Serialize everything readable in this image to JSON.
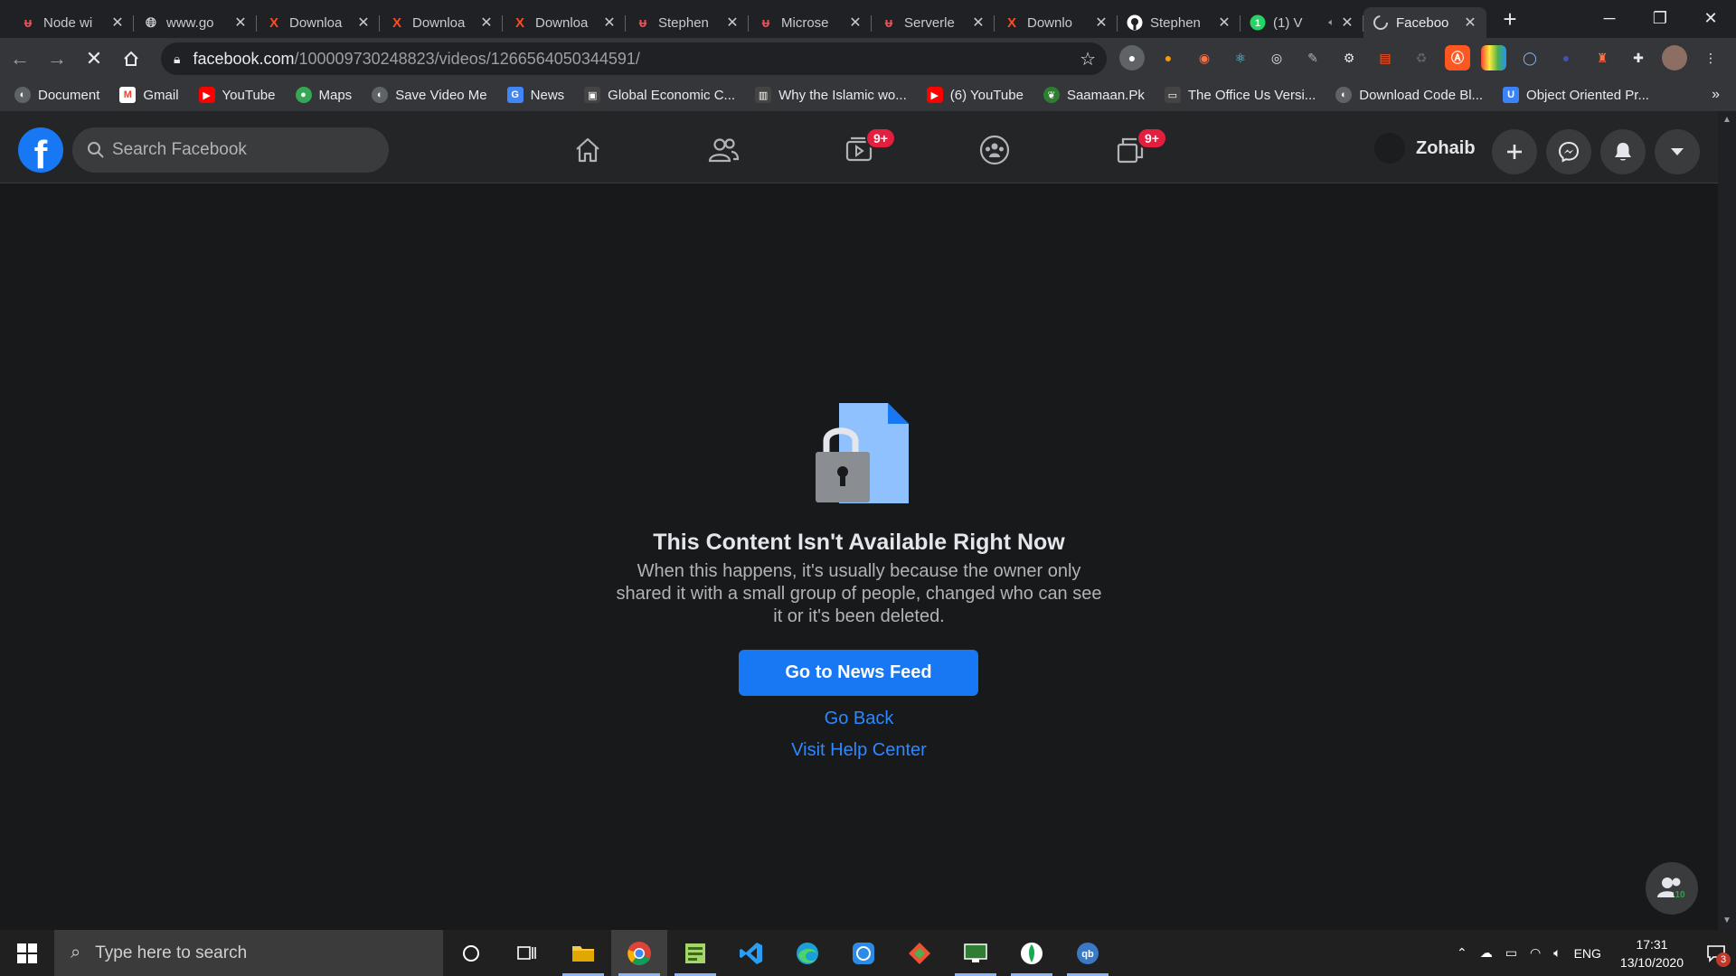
{
  "browser": {
    "tabs": [
      {
        "title": "Node wi",
        "icon": "udemy-icon",
        "color": "#ec5252"
      },
      {
        "title": "www.go",
        "icon": "globe-icon",
        "color": "#c8cacd"
      },
      {
        "title": "Downloa",
        "icon": "x-download-icon",
        "color": "#ff4a1c"
      },
      {
        "title": "Downloa",
        "icon": "x-download-icon",
        "color": "#ff4a1c"
      },
      {
        "title": "Downloa",
        "icon": "x-download-icon",
        "color": "#ff4a1c"
      },
      {
        "title": "Stephen",
        "icon": "udemy-icon",
        "color": "#ec5252"
      },
      {
        "title": "Microse",
        "icon": "udemy-icon",
        "color": "#ec5252"
      },
      {
        "title": "Serverle",
        "icon": "udemy-icon",
        "color": "#ec5252"
      },
      {
        "title": "Downlo",
        "icon": "x-download-icon",
        "color": "#ff4a1c"
      },
      {
        "title": "Stephen",
        "icon": "github-icon",
        "color": "#ffffff"
      },
      {
        "title": "(1) V",
        "icon": "whatsapp-icon",
        "color": "#25d366"
      },
      {
        "title": "Faceboo",
        "icon": "facebook-loading-icon",
        "color": "#c8cacd"
      }
    ],
    "new_tab_label": "+",
    "url_host": "facebook.com",
    "url_path": "/100009730248823/videos/1266564050344591/",
    "bookmarks": [
      {
        "label": "Document",
        "icon": "globe-icon",
        "color": "#5f6368"
      },
      {
        "label": "Gmail",
        "icon": "gmail-icon",
        "color": "#ea4335"
      },
      {
        "label": "YouTube",
        "icon": "youtube-icon",
        "color": "#ff0000"
      },
      {
        "label": "Maps",
        "icon": "maps-icon",
        "color": "#34a853"
      },
      {
        "label": "Save Video Me",
        "icon": "globe-icon",
        "color": "#5f6368"
      },
      {
        "label": "News",
        "icon": "news-icon",
        "color": "#4285f4"
      },
      {
        "label": "Global Economic C...",
        "icon": "site-icon",
        "color": "#444"
      },
      {
        "label": "Why the Islamic wo...",
        "icon": "site-icon",
        "color": "#444"
      },
      {
        "label": "(6) YouTube",
        "icon": "youtube-icon",
        "color": "#ff0000"
      },
      {
        "label": "Saamaan.Pk",
        "icon": "leaf-icon",
        "color": "#2e7d32"
      },
      {
        "label": "The Office Us Versi...",
        "icon": "tv-icon",
        "color": "#444"
      },
      {
        "label": "Download Code Bl...",
        "icon": "globe-icon",
        "color": "#5f6368"
      },
      {
        "label": "Object Oriented Pr...",
        "icon": "udemy-u-icon",
        "color": "#3b82f6"
      }
    ],
    "bookmarks_more": "»"
  },
  "facebook": {
    "search_placeholder": "Search Facebook",
    "watch_badge": "9+",
    "gaming_badge": "9+",
    "profile_name": "Zohaib",
    "contacts_count": "10"
  },
  "content": {
    "headline": "This Content Isn't Available Right Now",
    "description": "When this happens, it's usually because the owner only shared it with a small group of people, changed who can see it or it's been deleted.",
    "primary_button": "Go to News Feed",
    "go_back": "Go Back",
    "help_center": "Visit Help Center"
  },
  "taskbar": {
    "search_placeholder": "Type here to search",
    "language": "ENG",
    "time": "17:31",
    "date": "13/10/2020",
    "notification_count": "3"
  },
  "colors": {
    "fb_blue": "#1877f2",
    "link_blue": "#2d88ff",
    "badge_red": "#e41e3f"
  }
}
